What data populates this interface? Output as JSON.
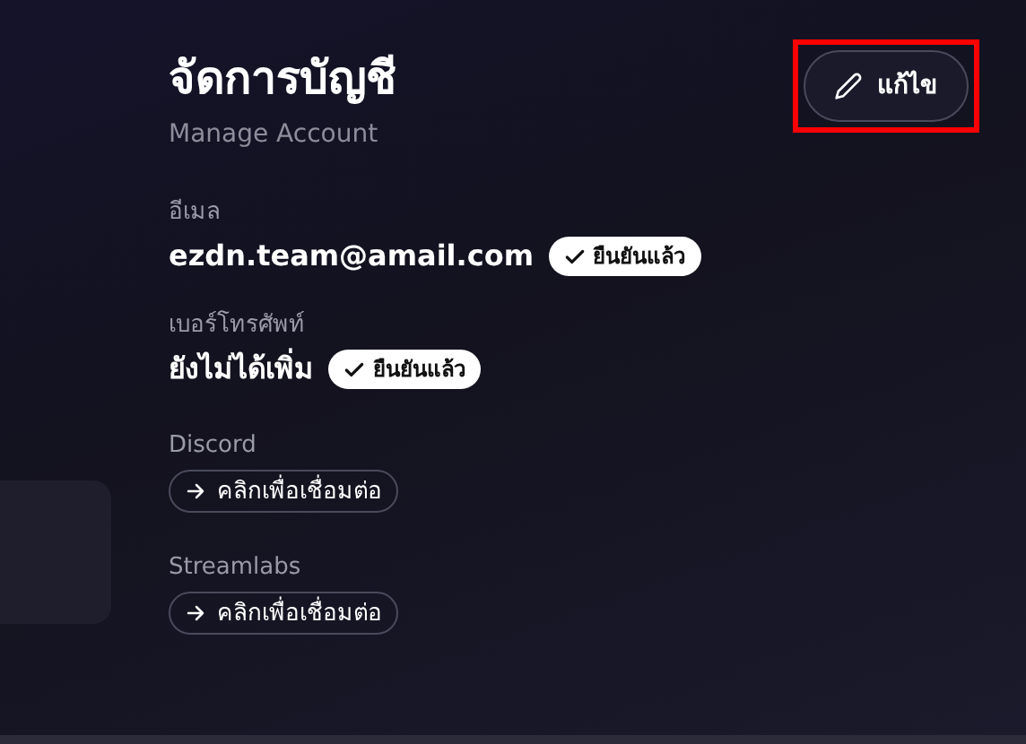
{
  "header": {
    "title": "จัดการบัญชี",
    "subtitle": "Manage Account"
  },
  "edit_button": {
    "label": "แก้ไข",
    "highlighted": true
  },
  "fields": [
    {
      "kind": "verified",
      "label": "อีเมล",
      "value": "ezdn.team@amail.com",
      "badge": "ยืนยันแล้ว"
    },
    {
      "kind": "verified",
      "label": "เบอร์โทรศัพท์",
      "value": "ยังไม่ได้เพิ่ม",
      "badge": "ยืนยันแล้ว"
    },
    {
      "kind": "connect",
      "label": "Discord",
      "action": "คลิกเพื่อเชื่อมต่อ"
    },
    {
      "kind": "connect",
      "label": "Streamlabs",
      "action": "คลิกเพื่อเชื่อมต่อ"
    }
  ]
}
